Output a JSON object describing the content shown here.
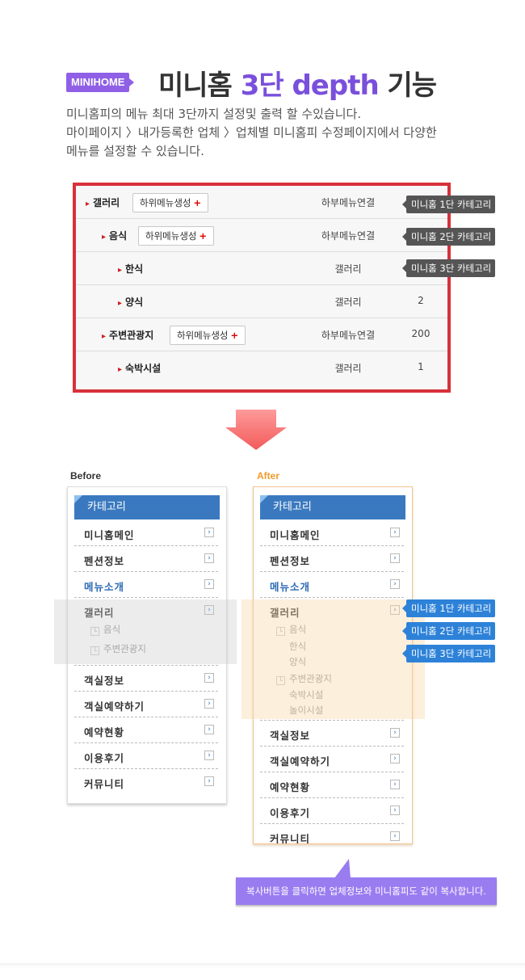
{
  "header": {
    "badge": "MINIHOME",
    "title_prefix": "미니홈 ",
    "title_highlight": "3단 depth",
    "title_suffix": " 기능",
    "desc_lines": [
      "미니홈피의 메뉴 최대 3단까지 설정및 출력 할 수있습니다.",
      "마이페이지 〉내가등록한 업체 〉업체별 미니홈피 수정페이지에서 다양한",
      "메뉴를 설정할 수 있습니다."
    ]
  },
  "settings": {
    "rows": [
      {
        "name": "갤러리",
        "button": "하위메뉴생성",
        "link": "하부메뉴연결",
        "value": ""
      },
      {
        "name": "음식",
        "button": "하위메뉴생성",
        "link": "하부메뉴연결",
        "value": ""
      },
      {
        "name": "한식",
        "button": "",
        "link": "갤러리",
        "value": ""
      },
      {
        "name": "양식",
        "button": "",
        "link": "갤러리",
        "value": "2"
      },
      {
        "name": "주변관광지",
        "button": "하위메뉴생성",
        "link": "하부메뉴연결",
        "value": "200"
      },
      {
        "name": "숙박시설",
        "button": "",
        "link": "갤러리",
        "value": "1"
      }
    ],
    "plus": "+",
    "tags": [
      "미니홈 1단 카테고리",
      "미니홈 2단 카테고리",
      "미니홈 3단 카테고리"
    ]
  },
  "before": {
    "label": "Before",
    "header": "카테고리",
    "items_top": [
      "미니홈메인",
      "펜션정보",
      "메뉴소개",
      "갤러리"
    ],
    "subs": [
      "음식",
      "주변관광지"
    ],
    "items_bottom": [
      "객실정보",
      "객실예약하기",
      "예약현황",
      "이용후기",
      "커뮤니티"
    ]
  },
  "after": {
    "label": "After",
    "header": "카테고리",
    "items_top": [
      "미니홈메인",
      "펜션정보",
      "메뉴소개",
      "갤러리"
    ],
    "sub1": "음식",
    "sub1_children": [
      "한식",
      "양식"
    ],
    "sub2": "주변관광지",
    "sub2_children": [
      "숙박시설",
      "놀이시설"
    ],
    "items_bottom": [
      "객실정보",
      "객실예약하기",
      "예약현황",
      "이용후기",
      "커뮤니티"
    ],
    "tags": [
      "미니홈 1단 카테고리",
      "미니홈 2단 카테고리",
      "미니홈 3단 카테고리"
    ]
  },
  "callout": "복사버튼을 클릭하면 업체정보와 미니홈피도 같이 복사합니다.",
  "icons": {
    "chevron": "›",
    "sub_marker": "└",
    "row_marker": "▸"
  },
  "colors": {
    "accent": "#7a4fdc",
    "border_red": "#d7313a",
    "menu_blue": "#3a79bf",
    "after_border": "#f2c58f"
  }
}
